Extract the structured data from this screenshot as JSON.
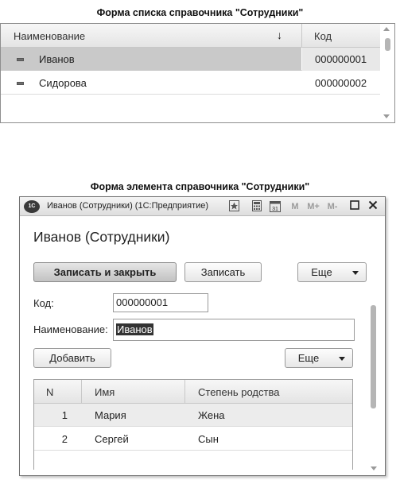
{
  "list_caption": "Форма списка справочника \"Сотрудники\"",
  "list": {
    "columns": {
      "name": "Наименование",
      "code": "Код"
    },
    "sort_indicator": "↓",
    "rows": [
      {
        "name": "Иванов",
        "code": "000000001"
      },
      {
        "name": "Сидорова",
        "code": "000000002"
      }
    ]
  },
  "element_caption": "Форма элемента справочника \"Сотрудники\"",
  "window": {
    "app_icon": "1С",
    "title": "Иванов (Сотрудники)  (1С:Предприятие)",
    "toolbar_icons": [
      "favorite-icon",
      "calculator-icon",
      "calendar-icon"
    ],
    "memory_buttons": [
      "M",
      "M+",
      "M-"
    ],
    "calendar_day": "31"
  },
  "form": {
    "title": "Иванов (Сотрудники)",
    "buttons": {
      "write_close": "Записать и закрыть",
      "write": "Записать",
      "more": "Еще"
    },
    "fields": {
      "code_label": "Код:",
      "code_value": "000000001",
      "name_label": "Наименование:",
      "name_value": "Иванов"
    },
    "add_button": "Добавить",
    "more_button": "Еще",
    "table": {
      "columns": {
        "n": "N",
        "name": "Имя",
        "relation": "Степень родства"
      },
      "rows": [
        {
          "n": "1",
          "name": "Мария",
          "relation": "Жена"
        },
        {
          "n": "2",
          "name": "Сергей",
          "relation": "Сын"
        }
      ]
    }
  }
}
